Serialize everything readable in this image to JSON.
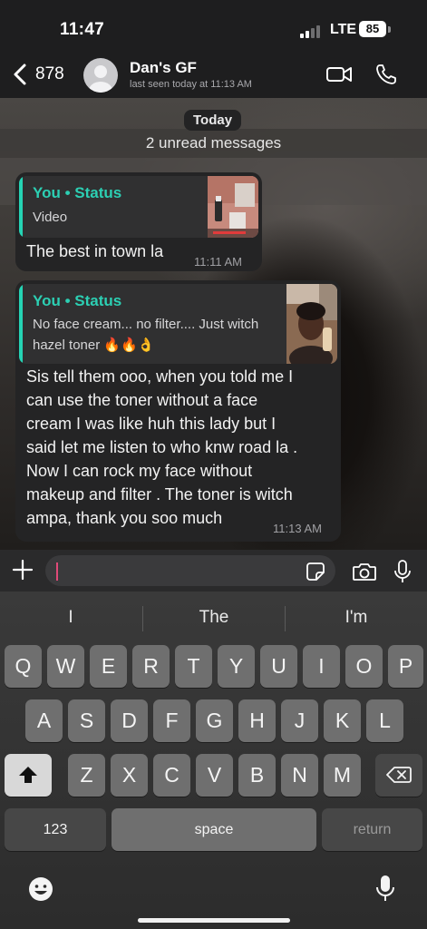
{
  "status_bar": {
    "time": "11:47",
    "network": "LTE",
    "battery": "85"
  },
  "header": {
    "back_count": "878",
    "contact_name": "Dan's GF",
    "last_seen": "last seen today at 11:13 AM"
  },
  "chat": {
    "date_label": "Today",
    "unread_label": "2 unread messages",
    "messages": [
      {
        "quote_title": "You • Status",
        "quote_text": "Video",
        "text": "The best in town la",
        "time": "11:11 AM"
      },
      {
        "quote_title": "You • Status",
        "quote_line1": "No face cream... no filter.... Just witch",
        "quote_line2": "hazel toner 🔥🔥👌",
        "lines": [
          "Sis tell them ooo, when you told me I",
          "can use the toner without a face",
          "cream I was like huh this lady  but  I",
          "said let me listen to who knw road la .",
          "Now I can rock my face without",
          "makeup and filter . The toner is witch",
          "ampa, thank you soo much"
        ],
        "time": "11:13 AM"
      }
    ]
  },
  "keyboard": {
    "suggestions": [
      "I",
      "The",
      "I'm"
    ],
    "row1": [
      "Q",
      "W",
      "E",
      "R",
      "T",
      "Y",
      "U",
      "I",
      "O",
      "P"
    ],
    "row2": [
      "A",
      "S",
      "D",
      "F",
      "G",
      "H",
      "J",
      "K",
      "L"
    ],
    "row3": [
      "Z",
      "X",
      "C",
      "V",
      "B",
      "N",
      "M"
    ],
    "numbers_label": "123",
    "space_label": "space",
    "return_label": "return"
  },
  "colors": {
    "accent_teal": "#2ccfb3",
    "bubble": "#242425",
    "header": "#1e1e1f",
    "cursor": "#e04a78"
  },
  "icons": [
    "back-icon",
    "avatar",
    "video-call-icon",
    "phone-call-icon",
    "plus-icon",
    "sticker-icon",
    "camera-icon",
    "microphone-icon",
    "shift-icon",
    "backspace-icon",
    "emoji-icon",
    "dictation-icon"
  ]
}
